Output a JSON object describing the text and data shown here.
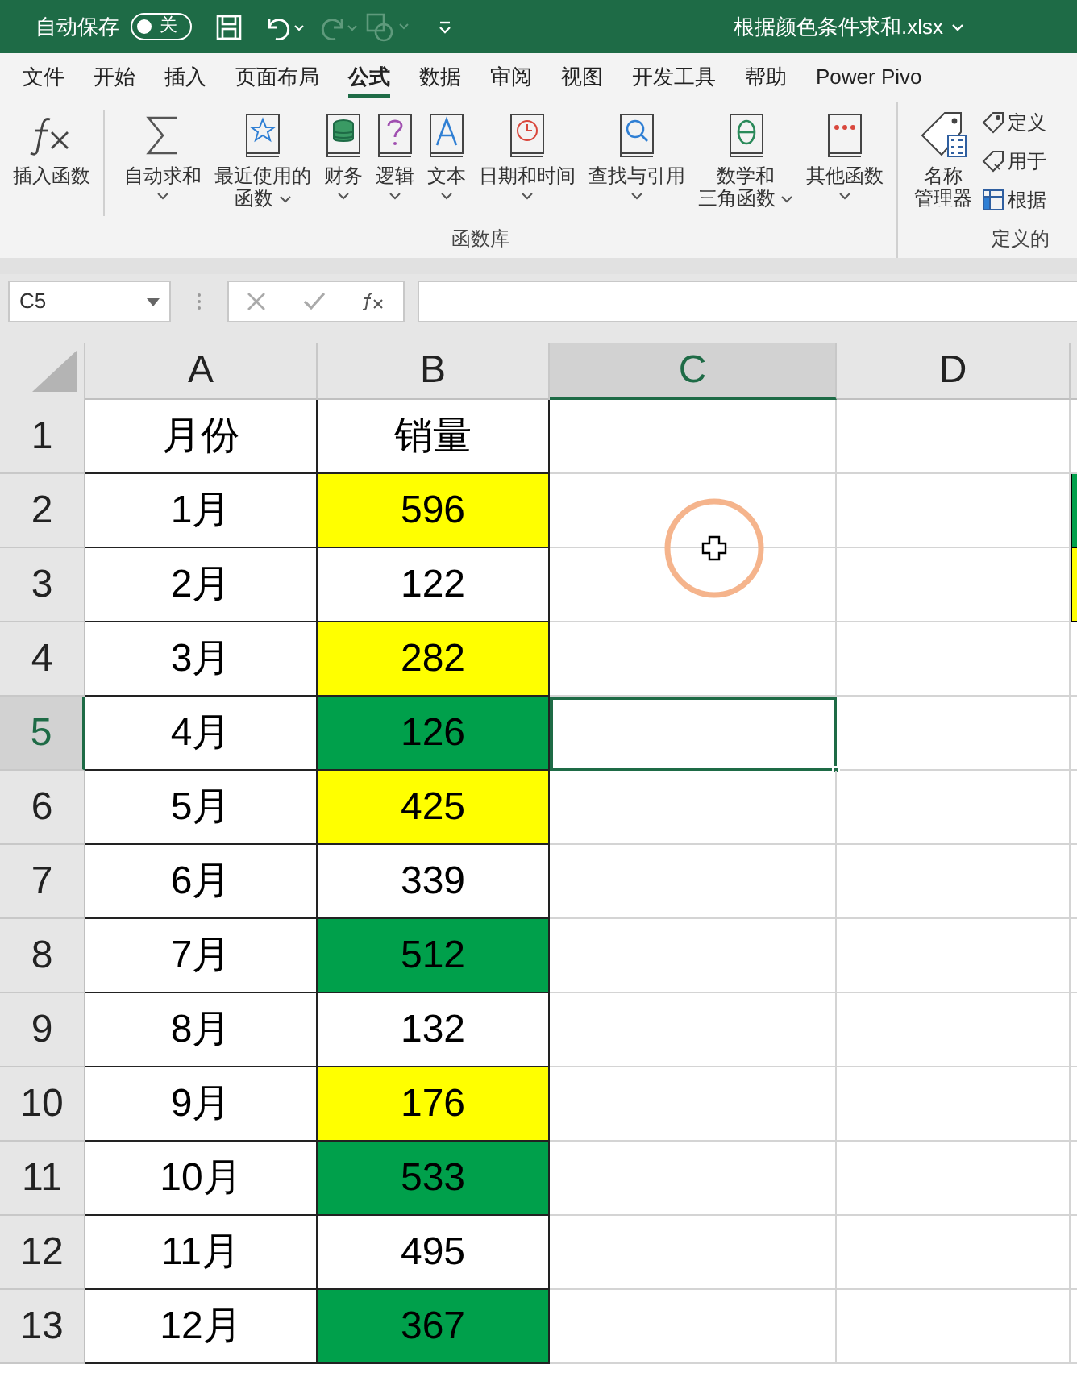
{
  "title_bar": {
    "autosave_label": "自动保存",
    "autosave_toggle": {
      "on": false,
      "label": "关"
    },
    "file_name": "根据颜色条件求和.xlsx"
  },
  "tabs": [
    {
      "label": "文件",
      "selected": false
    },
    {
      "label": "开始",
      "selected": false
    },
    {
      "label": "插入",
      "selected": false
    },
    {
      "label": "页面布局",
      "selected": false
    },
    {
      "label": "公式",
      "selected": true
    },
    {
      "label": "数据",
      "selected": false
    },
    {
      "label": "审阅",
      "selected": false
    },
    {
      "label": "视图",
      "selected": false
    },
    {
      "label": "开发工具",
      "selected": false
    },
    {
      "label": "帮助",
      "selected": false
    },
    {
      "label": "Power Pivo",
      "selected": false
    }
  ],
  "ribbon": {
    "groups": [
      {
        "label": "函数库",
        "buttons": [
          {
            "kind": "fx",
            "lines": [
              "插入函数"
            ],
            "dropdown": false
          },
          {
            "kind": "sigma",
            "lines": [
              "自动求和"
            ],
            "dropdown": true
          },
          {
            "kind": "star",
            "lines": [
              "最近使用的",
              "函数"
            ],
            "dropdown": true
          },
          {
            "kind": "coins",
            "lines": [
              "财务"
            ],
            "dropdown": true
          },
          {
            "kind": "question",
            "lines": [
              "逻辑"
            ],
            "dropdown": true
          },
          {
            "kind": "letter",
            "lines": [
              "文本"
            ],
            "dropdown": true
          },
          {
            "kind": "clock",
            "lines": [
              "日期和时间"
            ],
            "dropdown": true
          },
          {
            "kind": "search",
            "lines": [
              "查找与引用"
            ],
            "dropdown": true
          },
          {
            "kind": "theta",
            "lines": [
              "数学和",
              "三角函数"
            ],
            "dropdown": true
          },
          {
            "kind": "dots",
            "lines": [
              "其他函数"
            ],
            "dropdown": true
          }
        ]
      },
      {
        "label": "定义的",
        "buttons": [
          {
            "kind": "tag",
            "lines": [
              "名称",
              "管理器"
            ],
            "dropdown": false
          }
        ],
        "small_items": [
          "定义",
          "用于",
          "根据"
        ]
      }
    ]
  },
  "formula_bar": {
    "name_box": "C5"
  },
  "columns": [
    {
      "label": "A",
      "selected": false
    },
    {
      "label": "B",
      "selected": false
    },
    {
      "label": "C",
      "selected": true
    },
    {
      "label": "D",
      "selected": false
    }
  ],
  "rows": [
    {
      "header": "1",
      "selected": false,
      "a": {
        "text": "月份"
      },
      "b": {
        "text": "销量"
      }
    },
    {
      "header": "2",
      "selected": false,
      "a": {
        "text": "1月"
      },
      "b": {
        "text": "596",
        "color": "#ffff00"
      },
      "e": {
        "color": "#00a04b"
      }
    },
    {
      "header": "3",
      "selected": false,
      "a": {
        "text": "2月"
      },
      "b": {
        "text": "122"
      },
      "e": {
        "color": "#ffff00"
      }
    },
    {
      "header": "4",
      "selected": false,
      "a": {
        "text": "3月"
      },
      "b": {
        "text": "282",
        "color": "#ffff00"
      }
    },
    {
      "header": "5",
      "selected": true,
      "a": {
        "text": "4月"
      },
      "b": {
        "text": "126",
        "color": "#00a04b"
      }
    },
    {
      "header": "6",
      "selected": false,
      "a": {
        "text": "5月"
      },
      "b": {
        "text": "425",
        "color": "#ffff00"
      }
    },
    {
      "header": "7",
      "selected": false,
      "a": {
        "text": "6月"
      },
      "b": {
        "text": "339"
      }
    },
    {
      "header": "8",
      "selected": false,
      "a": {
        "text": "7月"
      },
      "b": {
        "text": "512",
        "color": "#00a04b"
      }
    },
    {
      "header": "9",
      "selected": false,
      "a": {
        "text": "8月"
      },
      "b": {
        "text": "132"
      }
    },
    {
      "header": "10",
      "selected": false,
      "a": {
        "text": "9月"
      },
      "b": {
        "text": "176",
        "color": "#ffff00"
      }
    },
    {
      "header": "11",
      "selected": false,
      "a": {
        "text": "10月"
      },
      "b": {
        "text": "533",
        "color": "#00a04b"
      }
    },
    {
      "header": "12",
      "selected": false,
      "a": {
        "text": "11月"
      },
      "b": {
        "text": "495"
      }
    },
    {
      "header": "13",
      "selected": false,
      "a": {
        "text": "12月"
      },
      "b": {
        "text": "367",
        "color": "#00a04b"
      }
    }
  ]
}
